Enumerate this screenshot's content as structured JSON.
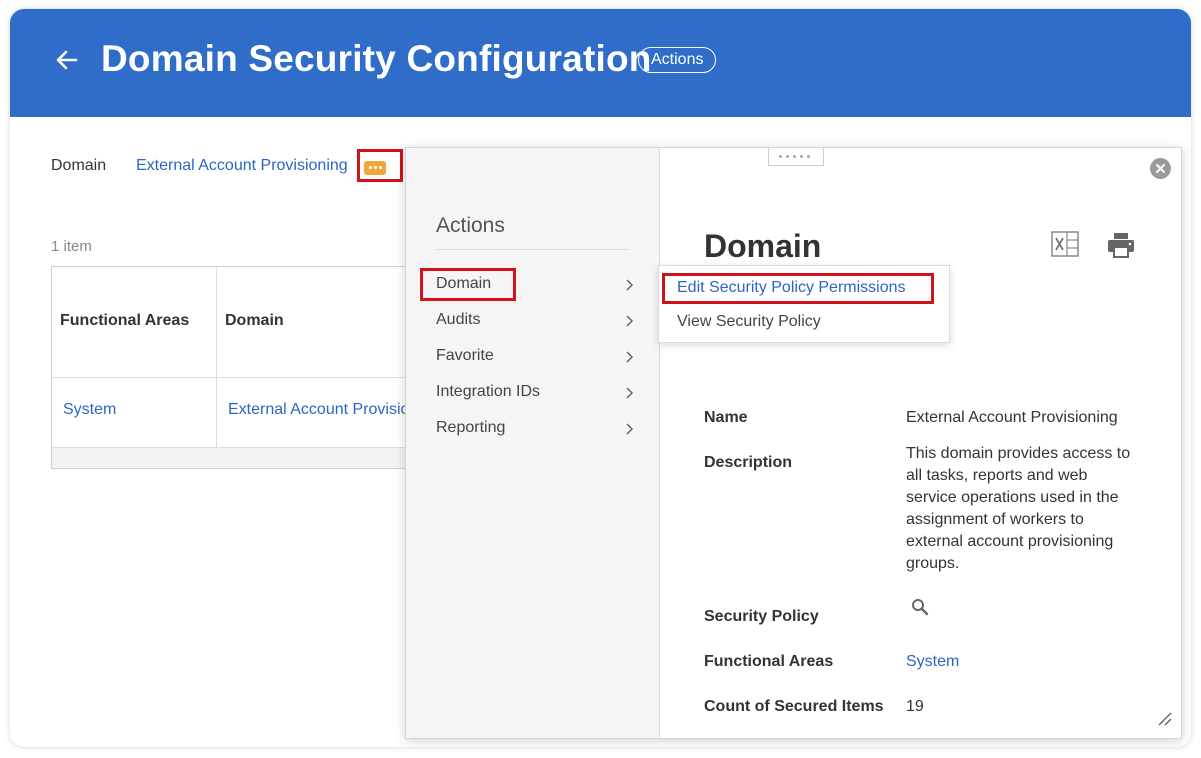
{
  "header": {
    "title": "Domain Security Configuration",
    "actions_label": "Actions",
    "background": "#2f6dc9"
  },
  "prompt": {
    "domain_label": "Domain",
    "domain_value": "External Account Provisioning"
  },
  "grid": {
    "item_count": "1 item",
    "columns": [
      "Functional Areas",
      "Domain"
    ],
    "rows": [
      [
        "System",
        "External Account Provisioning"
      ]
    ]
  },
  "actions_menu": {
    "title": "Actions",
    "items": [
      {
        "label": "Domain"
      },
      {
        "label": "Audits"
      },
      {
        "label": "Favorite"
      },
      {
        "label": "Integration IDs"
      },
      {
        "label": "Reporting"
      }
    ]
  },
  "submenu": {
    "items": [
      {
        "label": "Edit Security Policy Permissions"
      },
      {
        "label": "View Security Policy"
      }
    ]
  },
  "detail": {
    "title": "Domain",
    "fields": {
      "name_label": "Name",
      "name_value": "External Account Provisioning",
      "description_label": "Description",
      "description_value": "This domain provides access to all tasks, reports and web service operations used in the assignment of workers to external account provisioning groups.",
      "security_policy_label": "Security Policy",
      "functional_areas_label": "Functional Areas",
      "functional_areas_value": "System",
      "count_label": "Count of Secured Items",
      "count_value": "19"
    }
  },
  "colors": {
    "link": "#2c66c4",
    "highlight": "#d1111b",
    "related_button": "#f0a63a"
  },
  "icons": [
    "back-arrow-icon",
    "ellipsis-icon",
    "chevron-right-icon",
    "close-icon",
    "excel-icon",
    "print-icon",
    "search-icon",
    "resize-grip-icon",
    "drag-handle-icon"
  ]
}
